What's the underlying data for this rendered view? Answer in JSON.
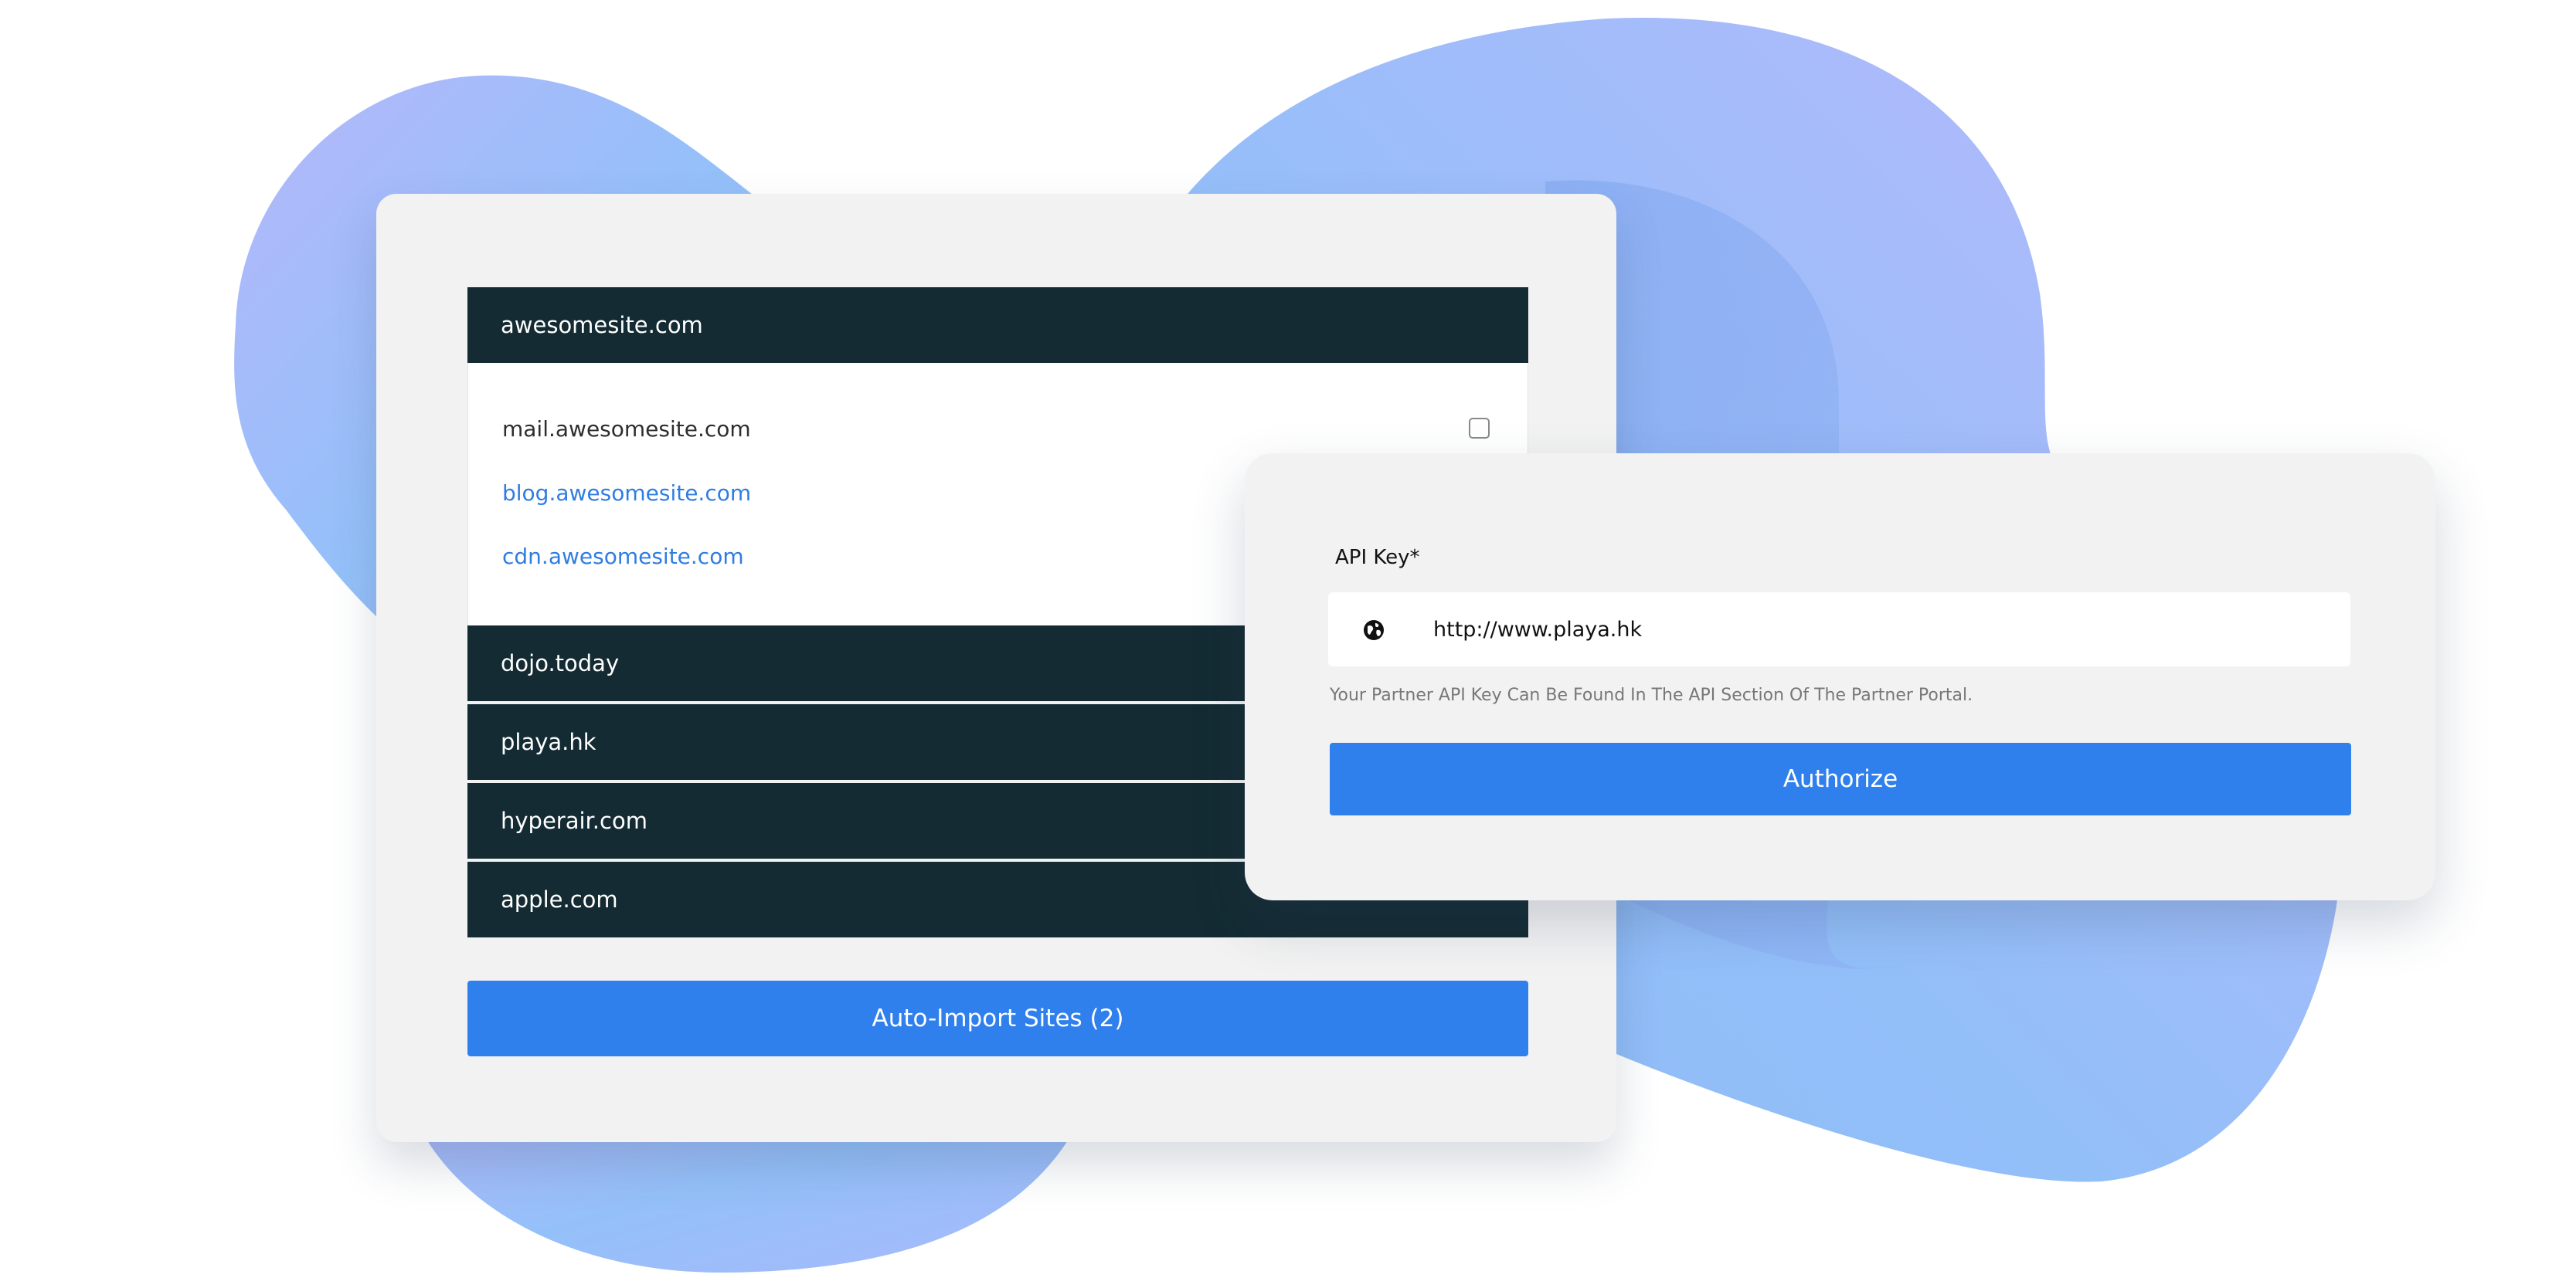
{
  "sites_panel": {
    "sites": [
      {
        "name": "awesomesite.com",
        "expanded": true,
        "subsites": [
          {
            "name": "mail.awesomesite.com",
            "style": "dark"
          },
          {
            "name": "blog.awesomesite.com",
            "style": "link"
          },
          {
            "name": "cdn.awesomesite.com",
            "style": "link"
          }
        ]
      },
      {
        "name": "dojo.today"
      },
      {
        "name": "playa.hk"
      },
      {
        "name": "hyperair.com"
      },
      {
        "name": "apple.com"
      }
    ],
    "import_button_label": "Auto-Import Sites (2)"
  },
  "api_panel": {
    "label": "API Key*",
    "input_value": "http://www.playa.hk",
    "help_text": "Your Partner API Key Can Be Found In The API Section Of The Partner Portal.",
    "authorize_label": "Authorize",
    "input_icon": "globe-icon"
  },
  "colors": {
    "accent": "#2f80ed",
    "header_dark": "#142b33",
    "link": "#2f7de1",
    "panel_bg": "#f2f2f2"
  }
}
